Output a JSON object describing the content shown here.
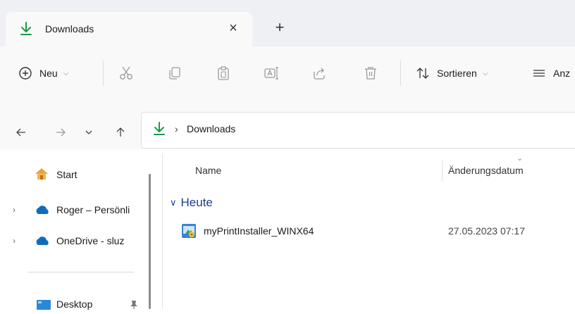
{
  "tab": {
    "title": "Downloads",
    "close_symbol": "×",
    "add_symbol": "+"
  },
  "toolbar": {
    "new_label": "Neu",
    "sort_label": "Sortieren",
    "view_label_partial": "Anz"
  },
  "address": {
    "path_separator": "›",
    "location": "Downloads"
  },
  "sidebar": {
    "items": [
      {
        "label": "Start",
        "icon": "home-icon"
      },
      {
        "label": "Roger – Persönli",
        "icon": "onedrive-cloud-icon"
      },
      {
        "label": "OneDrive - sluz",
        "icon": "onedrive-cloud-icon"
      },
      {
        "label": "Desktop",
        "icon": "desktop-folder-icon"
      }
    ]
  },
  "content": {
    "columns": {
      "name": "Name",
      "date": "Änderungsdatum"
    },
    "group": "Heute",
    "files": [
      {
        "name": "myPrintInstaller_WINX64",
        "modified": "27.05.2023 07:17",
        "icon": "installer-icon"
      }
    ]
  },
  "colors": {
    "download_green": "#1a9a4a",
    "group_blue": "#1b3d8a",
    "onedrive_blue": "#0f6cbd",
    "folder_blue": "#2b88d8"
  }
}
